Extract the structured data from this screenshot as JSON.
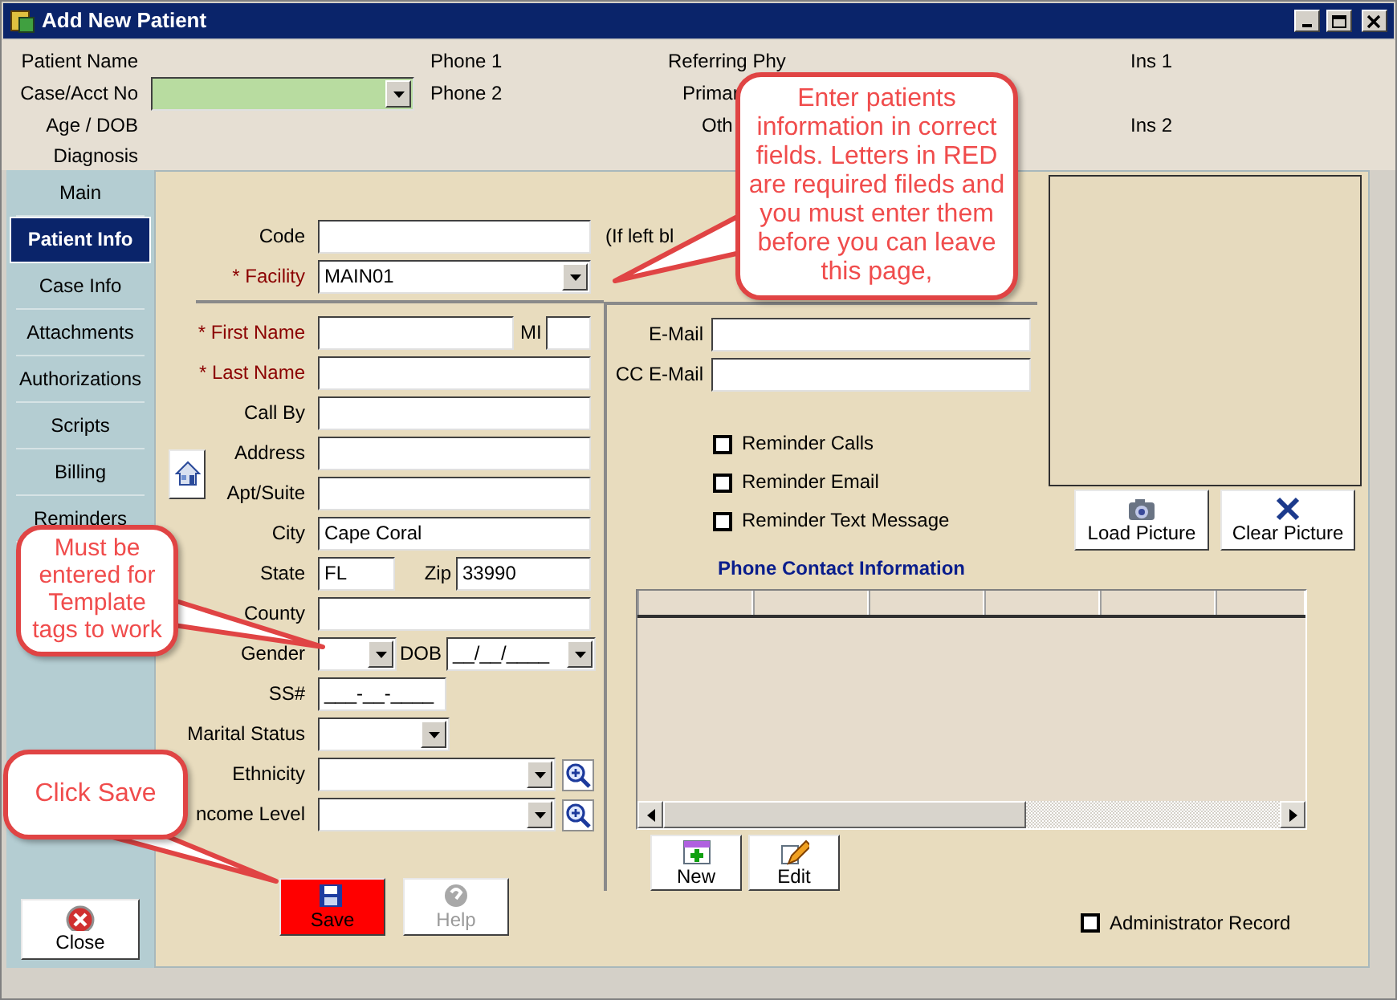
{
  "window": {
    "title": "Add New Patient"
  },
  "header": [
    [
      {
        "label": "Patient Name"
      },
      {
        "label": "Case/Acct No",
        "kind": "combo"
      },
      {
        "label": "Age / DOB"
      },
      {
        "label": "Diagnosis"
      }
    ],
    [
      {
        "label": "Phone 1"
      },
      {
        "label": "Phone 2"
      }
    ],
    [
      {
        "label": "Referring Phy"
      },
      {
        "label": "Primar"
      },
      {
        "label": "Oth"
      }
    ],
    [
      {
        "label": "Ins 1"
      },
      {
        "label": "Ins 2"
      }
    ]
  ],
  "sidebar": {
    "items": [
      {
        "label": "Main",
        "selected": false
      },
      {
        "label": "Patient Info",
        "selected": true
      },
      {
        "label": "Case Info",
        "selected": false
      },
      {
        "label": "Attachments",
        "selected": false
      },
      {
        "label": "Authorizations",
        "selected": false
      },
      {
        "label": "Scripts",
        "selected": false
      },
      {
        "label": "Billing",
        "selected": false
      },
      {
        "label": "Reminders",
        "selected": false
      }
    ],
    "close_button": {
      "label": "Close"
    }
  },
  "top_fields": [
    {
      "label": "Code",
      "kind": "text",
      "required": false
    },
    {
      "label": "* Facility",
      "kind": "combo",
      "required": true,
      "value": "MAIN01"
    }
  ],
  "code_note": "(If left bl",
  "fields": [
    {
      "label": "* First Name",
      "kind": "name",
      "required": true,
      "mi_label": "MI"
    },
    {
      "label": "* Last Name",
      "kind": "text",
      "required": true
    },
    {
      "label": "Call By",
      "kind": "text",
      "required": false
    },
    {
      "label": "Address",
      "kind": "address",
      "required": false
    },
    {
      "label": "Apt/Suite",
      "kind": "address",
      "required": false
    },
    {
      "label": "City",
      "kind": "text",
      "required": false,
      "value": "Cape Coral"
    },
    {
      "label": "State",
      "kind": "state",
      "required": false,
      "value": "FL",
      "zip_label": "Zip",
      "zip_value": "33990"
    },
    {
      "label": "County",
      "kind": "text",
      "required": false
    },
    {
      "label": "Gender",
      "kind": "gender",
      "required": false,
      "dob_label": "DOB",
      "dob_value": "__/__/____"
    },
    {
      "label": "SS#",
      "kind": "masked",
      "required": false,
      "value": "___-__-____"
    },
    {
      "label": "Marital Status",
      "kind": "short_combo",
      "required": false
    },
    {
      "label": "Ethnicity",
      "kind": "lookup",
      "required": false
    },
    {
      "label": "ncome Level",
      "kind": "lookup",
      "required": false
    }
  ],
  "actions": [
    {
      "label": "Save",
      "kind": "save",
      "disabled": false
    },
    {
      "label": "Help",
      "kind": "help",
      "disabled": true
    }
  ],
  "contact": {
    "email_fields": [
      {
        "label": "E-Mail"
      },
      {
        "label": "CC E-Mail"
      }
    ],
    "reminders": [
      {
        "label": "Reminder Calls",
        "checked": false
      },
      {
        "label": "Reminder Email",
        "checked": false
      },
      {
        "label": "Reminder Text Message",
        "checked": false
      }
    ],
    "phone_title": "Phone Contact Information",
    "phone_buttons": [
      {
        "label": "New",
        "kind": "new"
      },
      {
        "label": "Edit",
        "kind": "edit"
      }
    ],
    "admin": {
      "label": "Administrator Record",
      "checked": false
    }
  },
  "picture_buttons": [
    {
      "label": "Load Picture",
      "kind": "load"
    },
    {
      "label": "Clear Picture",
      "kind": "clear"
    }
  ],
  "callouts": [
    {
      "text": "Enter patients information in correct fields. Letters in RED are required fileds and you must enter them before you can leave this page,"
    },
    {
      "text": "Must be entered for Template tags to work"
    },
    {
      "text": "Click Save"
    }
  ]
}
